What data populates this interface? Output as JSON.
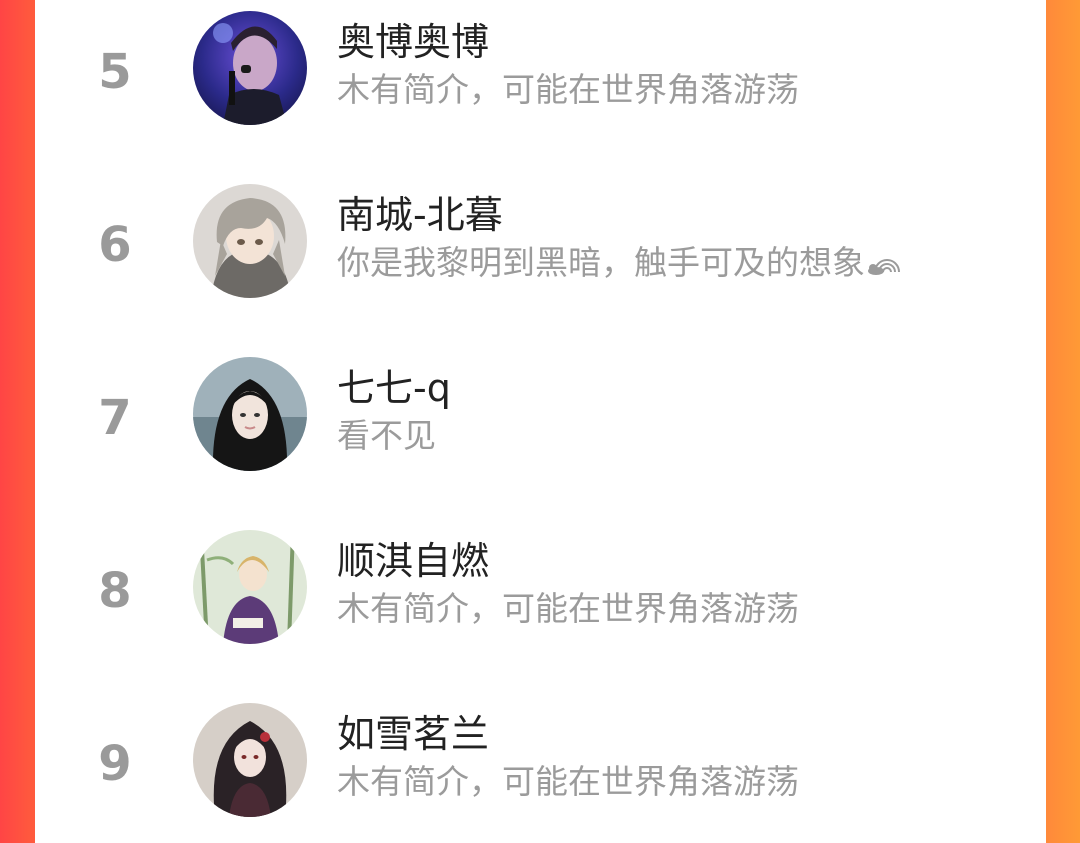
{
  "leaderboard": {
    "rows": [
      {
        "rank": "5",
        "name": "奥博奥博",
        "bio": "木有简介，可能在世界角落游荡",
        "avatar_icon": "singer-avatar-icon"
      },
      {
        "rank": "6",
        "name": "南城-北暮",
        "bio": "你是我黎明到黑暗，触手可及的想象",
        "bio_emoji": "rainbow-cloud-icon",
        "avatar_icon": "anime-boy-avatar-icon"
      },
      {
        "rank": "7",
        "name": "七七-q",
        "bio": "看不见",
        "avatar_icon": "girl-avatar-icon"
      },
      {
        "rank": "8",
        "name": "顺淇自燃",
        "bio": "木有简介，可能在世界角落游荡",
        "avatar_icon": "anime-scholar-avatar-icon"
      },
      {
        "rank": "9",
        "name": "如雪茗兰",
        "bio": "木有简介，可能在世界角落游荡",
        "avatar_icon": "anime-girl-avatar-icon"
      }
    ]
  },
  "colors": {
    "background_left": "#ff4545",
    "background_right": "#ff9a36",
    "rank_text": "#9a9a9a",
    "name_text": "#222222",
    "bio_text": "#9b9b9b"
  }
}
